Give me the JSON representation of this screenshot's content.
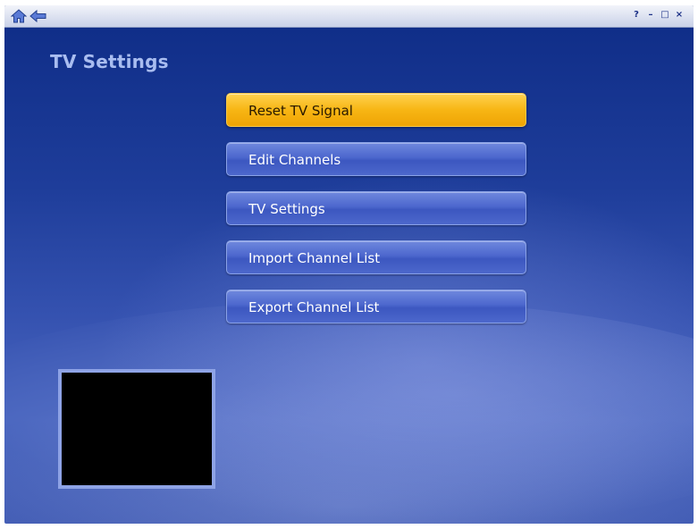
{
  "window": {
    "help_label": "?",
    "minimize_label": "–",
    "maximize_label": "□",
    "close_label": "×"
  },
  "icons": {
    "home": "home-icon",
    "back": "back-arrow-icon"
  },
  "page": {
    "title": "TV Settings"
  },
  "menu": {
    "items": [
      {
        "label": "Reset TV Signal",
        "focused": true
      },
      {
        "label": "Edit Channels",
        "focused": false
      },
      {
        "label": "TV Settings",
        "focused": false
      },
      {
        "label": "Import Channel List",
        "focused": false
      },
      {
        "label": "Export Channel List",
        "focused": false
      }
    ]
  },
  "colors": {
    "background": "#1e3d9a",
    "button": "#4c67cd",
    "focused_button": "#f7b614",
    "title_text": "#a9bdf0",
    "preview_border": "#8ea3e6"
  }
}
